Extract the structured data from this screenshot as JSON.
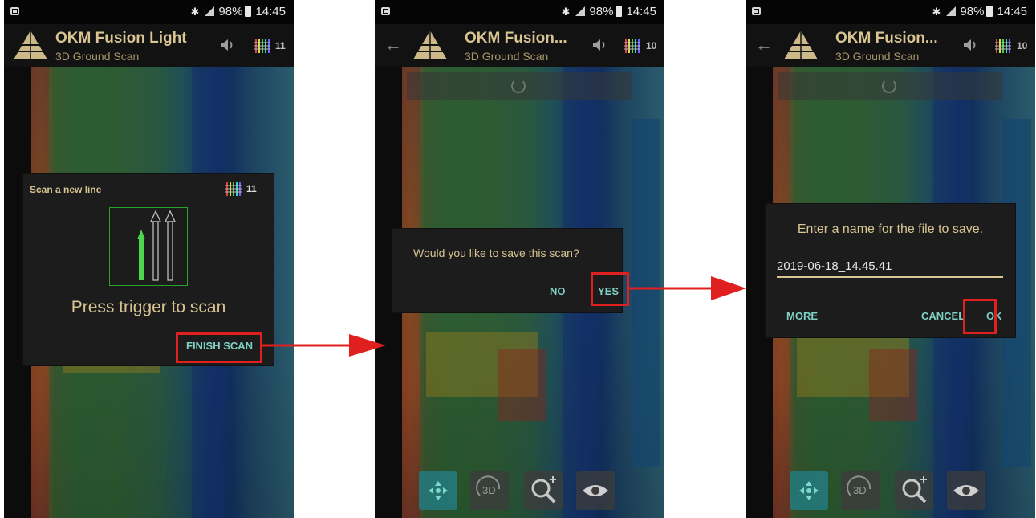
{
  "status_bar": {
    "battery": "98%",
    "time": "14:45"
  },
  "app_bar": [
    {
      "title": "OKM Fusion Light",
      "subtitle": "3D Ground Scan",
      "line_count": "11"
    },
    {
      "title": "OKM Fusion...",
      "subtitle": "3D Ground Scan",
      "line_count": "10"
    },
    {
      "title": "OKM Fusion...",
      "subtitle": "3D Ground Scan",
      "line_count": "10"
    }
  ],
  "scan_dialog": {
    "title": "Scan a new line",
    "line_count": "11",
    "message": "Press trigger to scan",
    "finish_label": "FINISH SCAN"
  },
  "save_dialog": {
    "question": "Would you like to save this scan?",
    "no_label": "NO",
    "yes_label": "YES"
  },
  "name_dialog": {
    "prompt": "Enter a name for the file to save.",
    "filename": "2019-06-18_14.45.41",
    "more_label": "MORE",
    "cancel_label": "CANCEL",
    "ok_label": "OK"
  },
  "toolbar": {
    "rotate_label": "3D"
  },
  "colors": {
    "highlight": "#e01f1f",
    "accent_text": "#d8c592",
    "button_text": "#7fd0c5",
    "arrow": "#22cc22"
  },
  "icons": [
    "screenshot-icon",
    "bluetooth-icon",
    "signal-icon",
    "battery-icon",
    "back-arrow-icon",
    "okm-logo-icon",
    "speaker-icon",
    "scan-lines-icon",
    "move-icon",
    "rotate-3d-icon",
    "zoom-icon",
    "eye-icon"
  ]
}
